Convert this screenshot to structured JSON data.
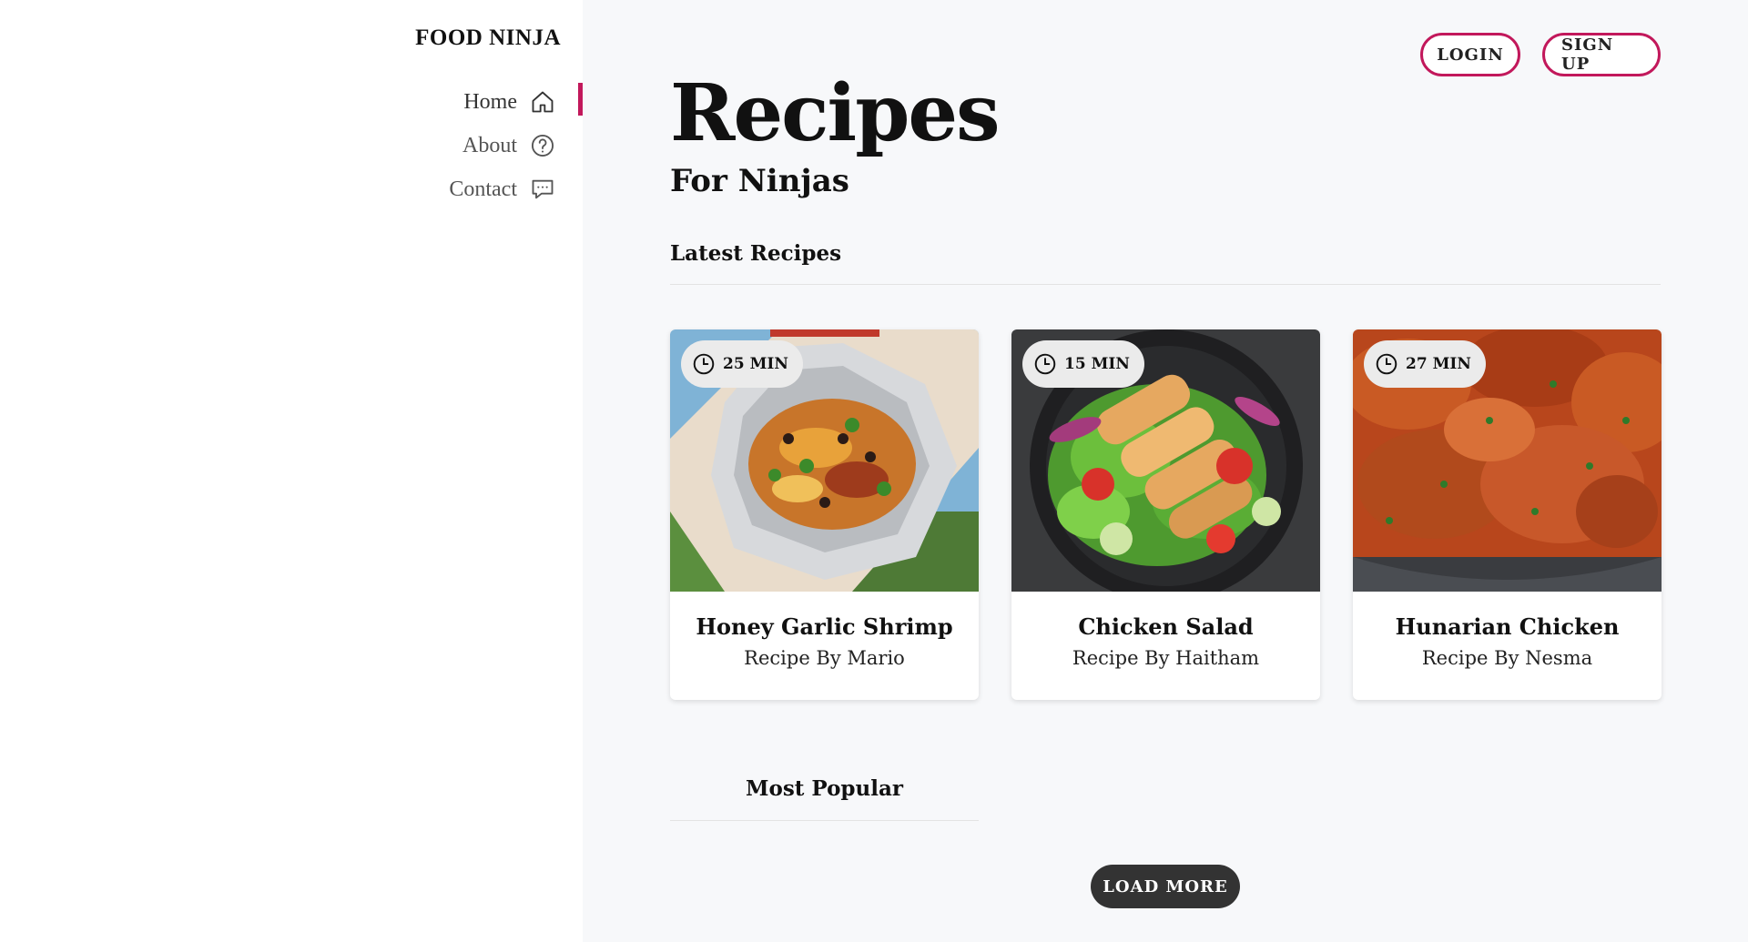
{
  "sidebar": {
    "brand": "FOOD NINJA",
    "items": [
      {
        "label": "Home",
        "icon": "home-icon",
        "active": true
      },
      {
        "label": "About",
        "icon": "help-circle-icon",
        "active": false
      },
      {
        "label": "Contact",
        "icon": "chat-icon",
        "active": false
      }
    ]
  },
  "header": {
    "login_label": "LOGIN",
    "signup_label": "SIGN UP"
  },
  "hero": {
    "title": "Recipes",
    "subtitle": "For Ninjas"
  },
  "latest": {
    "heading": "Latest Recipes",
    "cards": [
      {
        "time": "25 MIN",
        "title": "Honey Garlic Shrimp",
        "author": "Recipe By Mario"
      },
      {
        "time": "15 MIN",
        "title": "Chicken Salad",
        "author": "Recipe By Haitham"
      },
      {
        "time": "27 MIN",
        "title": "Hunarian Chicken",
        "author": "Recipe By Nesma"
      }
    ]
  },
  "popular": {
    "heading": "Most Popular"
  },
  "load_more_label": "LOAD MORE",
  "colors": {
    "accent": "#c2185b",
    "button_dark": "#333333",
    "main_bg": "#f7f8fa"
  }
}
